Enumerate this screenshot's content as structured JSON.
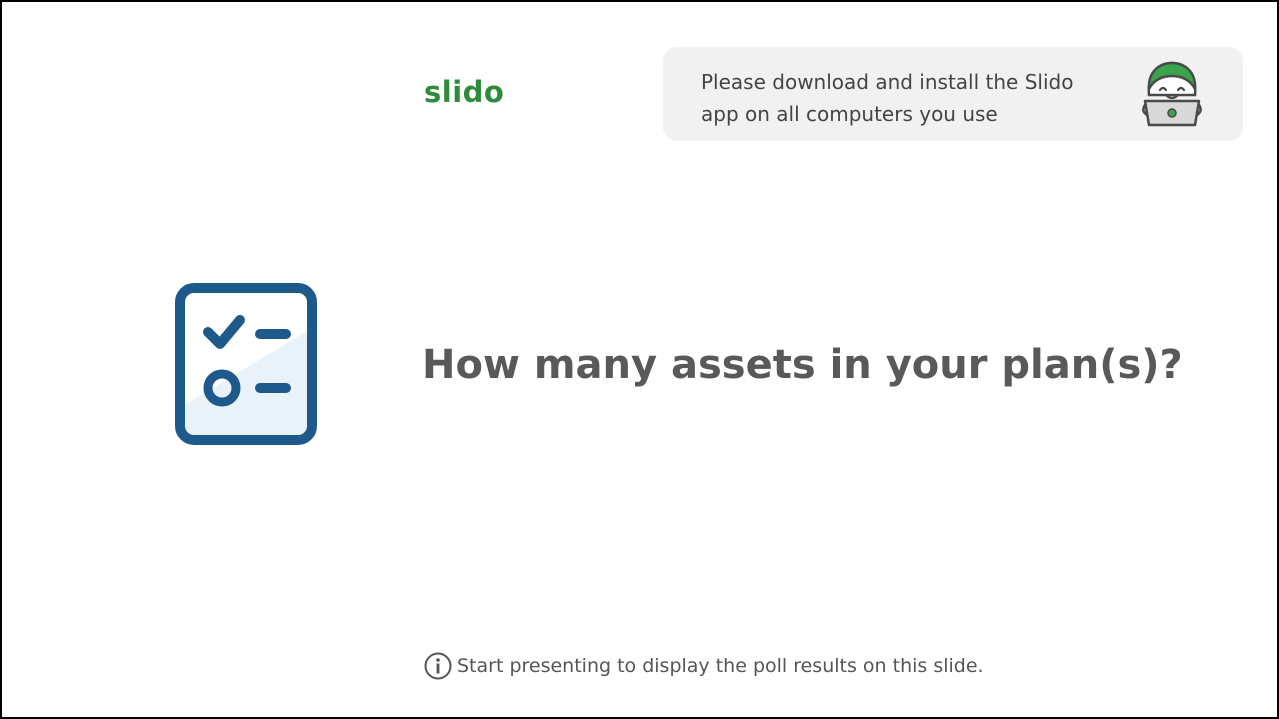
{
  "logo": {
    "text": "slido",
    "color": "#2e8b3a"
  },
  "banner": {
    "line1": "Please download and install the Slido",
    "line2": "app on all computers you use",
    "mascot_icon": "slido-mascot-laptop-icon",
    "background": "#f1f1f1"
  },
  "poll": {
    "icon": "poll-checklist-icon",
    "icon_color": "#1d5a8b",
    "question": "How many assets in your plan(s)?"
  },
  "footer": {
    "icon": "info-icon",
    "text": "Start presenting to display the poll results on this slide."
  }
}
